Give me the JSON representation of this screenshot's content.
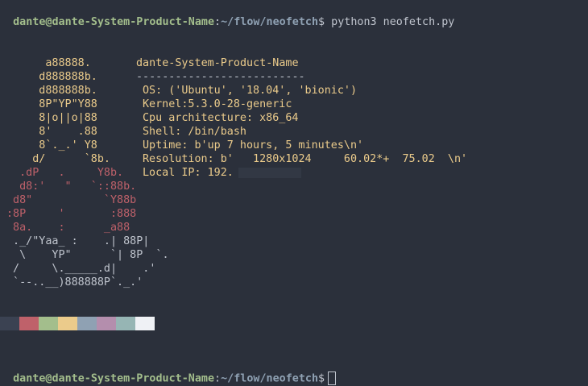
{
  "prompt1": {
    "user_host": "dante@dante-System-Product-Name",
    "sep": ":",
    "path": "~/flow/neofetch",
    "symbol": "$",
    "command": " python3 neofetch.py"
  },
  "info": {
    "hostname": "dante-System-Product-Name",
    "divider": "--------------------------",
    "os": "OS: ('Ubuntu', '18.04', 'bionic')",
    "kernel": "Kernel:5.3.0-28-generic",
    "cpu": "Cpu architecture: x86_64",
    "shell": "Shell: /bin/bash",
    "uptime": "Uptime: b'up 7 hours, 5 minutes\\n'",
    "resolution": "Resolution: b'   1280x1024     60.02*+  75.02  \\n'",
    "local_ip": "Local IP: 192."
  },
  "logo": [
    "      a88888.",
    "     d888888b.",
    "     d888888b.",
    "     8P\"YP\"Y88",
    "     8|o||o|88",
    "     8'    .88",
    "     8`._.' Y8",
    "    d/      `8b.",
    "  .dP   .     Y8b.",
    "  d8:'   \"   `::88b.",
    " d8\"           `Y88b",
    ":8P     '       :888",
    " 8a.    :      _a88",
    " ._/\"Yaa_ :    .| 88P|",
    "  \\    YP\"      `| 8P  `.",
    " /     \\._____.d|    .'",
    " `--..__)888888P`._.'"
  ],
  "palette": [
    "#3b4252",
    "#bf616a",
    "#a3be8c",
    "#ebcb8b",
    "#8fa1b3",
    "#b48ead",
    "#96b5b4",
    "#eff1f5"
  ],
  "prompt2": {
    "user_host": "dante@dante-System-Product-Name",
    "sep": ":",
    "path": "~/flow/neofetch",
    "symbol": "$"
  }
}
